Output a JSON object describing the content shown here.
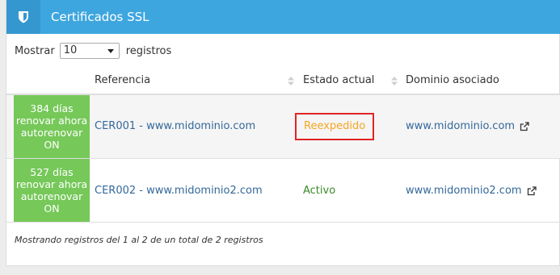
{
  "header": {
    "title": "Certificados SSL",
    "icon": "shield-icon",
    "bg_color": "#3ea6df"
  },
  "length": {
    "label_before": "Mostrar",
    "value": "10",
    "label_after": "registros"
  },
  "columns": [
    {
      "label": "Referencia"
    },
    {
      "label": "Estado actual"
    },
    {
      "label": "Dominio asociado"
    }
  ],
  "rows": [
    {
      "status": [
        "384 días",
        "renovar ahora",
        "autorenovar",
        "ON"
      ],
      "reference": "CER001 - www.midominio.com",
      "state": "Reexpedido",
      "domain": "www.midominio.com"
    },
    {
      "status": [
        "527 días",
        "renovar ahora",
        "autorenovar",
        "ON"
      ],
      "reference": "CER002 - www.midominio2.com",
      "state": "Activo",
      "domain": "www.midominio2.com"
    }
  ],
  "info": "Mostrando registros del 1 al 2 de un total de 2 registros",
  "colors": {
    "status_green": "#76c859",
    "reexpedido": "#f5a623",
    "activo": "#3a8a2a",
    "link": "#34689a"
  }
}
